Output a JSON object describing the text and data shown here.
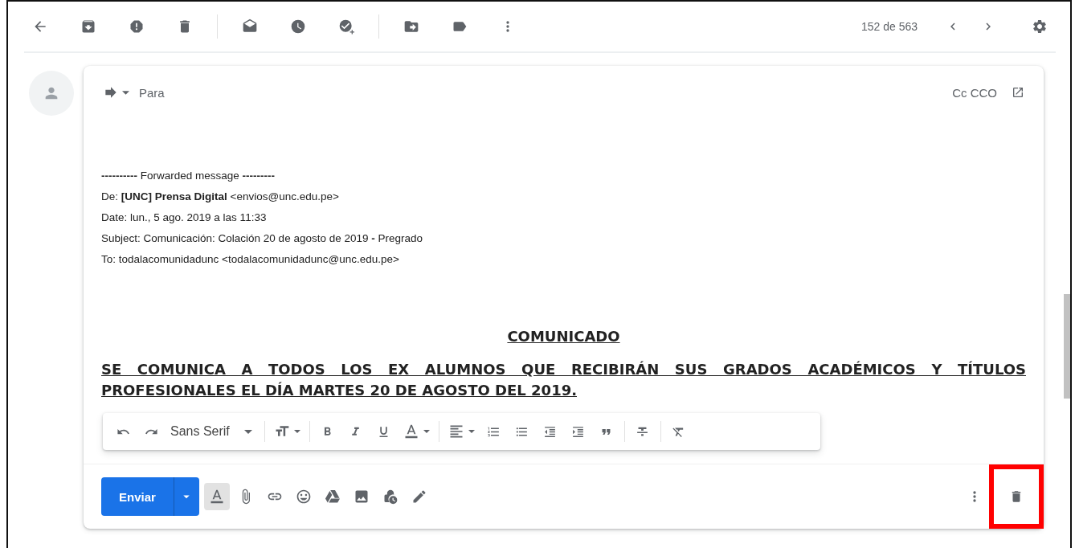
{
  "toolbar": {
    "back": {
      "kind": "back"
    },
    "action_groups": [
      [
        {
          "kind": "archive"
        },
        {
          "kind": "report"
        },
        {
          "kind": "delete"
        }
      ],
      [
        {
          "kind": "mark-unread"
        },
        {
          "kind": "snooze"
        },
        {
          "kind": "add-task"
        }
      ],
      [
        {
          "kind": "move-to"
        },
        {
          "kind": "label"
        },
        {
          "kind": "more"
        }
      ]
    ],
    "counter": "152 de 563",
    "nav": [
      {
        "kind": "chevron-left"
      },
      {
        "kind": "chevron-right"
      }
    ],
    "settings": {
      "kind": "settings"
    }
  },
  "compose": {
    "to_label": "Para",
    "cc_bcc": "Cc CCO",
    "forwarded": [
      "**----------** Forwarded message **---------**",
      "De: **[UNC] Prensa Digital** <envios@unc.edu.pe>",
      "Date: lun., 5 ago. 2019 a las 11:33",
      "Subject: Comunicación: Colación 20 de agosto de 2019 **-** Pregrado",
      "To: todalacomunidadunc <todalacomunidadunc@unc.edu.pe>"
    ],
    "announcement_title": "COMUNICADO",
    "headline": "SE COMUNICA A TODOS LOS EX ALUMNOS QUE RECIBIRÁN SUS GRADOS ACADÉMICOS Y TÍTULOS PROFESIONALES EL DÍA MARTES 20 DE AGOSTO DEL 2019.",
    "format_toolbar": {
      "font": "Sans Serif",
      "groups": [
        [
          {
            "kind": "undo"
          },
          {
            "kind": "redo"
          }
        ],
        [
          {
            "kind": "font"
          }
        ],
        [
          {
            "kind": "text-size"
          }
        ],
        [
          {
            "kind": "bold"
          },
          {
            "kind": "italic"
          },
          {
            "kind": "underline"
          },
          {
            "kind": "text-color"
          }
        ],
        [
          {
            "kind": "align"
          },
          {
            "kind": "numbered"
          },
          {
            "kind": "bulleted"
          },
          {
            "kind": "indent-less"
          },
          {
            "kind": "indent-more"
          },
          {
            "kind": "quote"
          }
        ],
        [
          {
            "kind": "strike"
          }
        ],
        [
          {
            "kind": "clear-format"
          }
        ]
      ]
    },
    "send_button": "Enviar",
    "tools": [
      {
        "kind": "text-color",
        "selected": true
      },
      {
        "kind": "attach",
        "selected": false
      },
      {
        "kind": "link",
        "selected": false
      },
      {
        "kind": "emoji",
        "selected": false
      },
      {
        "kind": "drive",
        "selected": false
      },
      {
        "kind": "photo",
        "selected": false
      },
      {
        "kind": "confidential",
        "selected": false
      },
      {
        "kind": "signature",
        "selected": false
      }
    ],
    "discard": {
      "kind": "delete",
      "highlighted": true
    }
  }
}
